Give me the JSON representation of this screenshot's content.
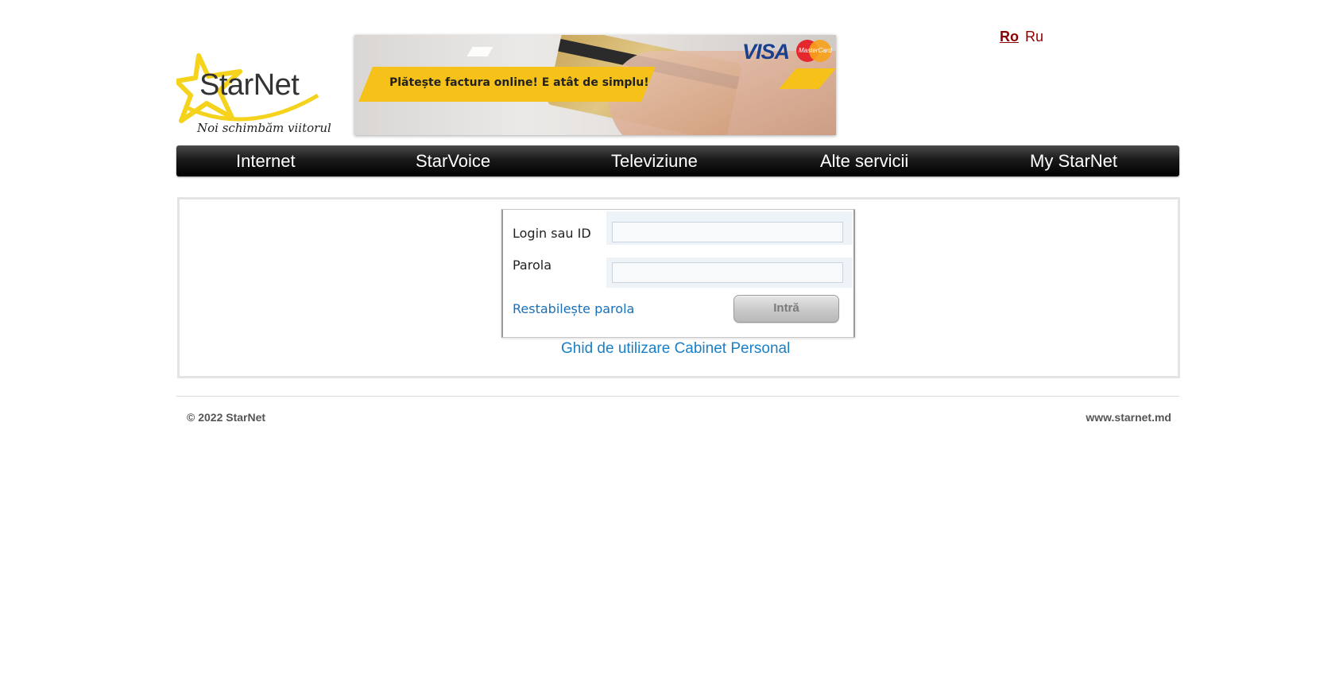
{
  "header": {
    "logo": {
      "name": "StarNet",
      "tagline": "Noi schimbăm viitorul"
    },
    "banner": {
      "text": "Plătește factura online! E atât de simplu!",
      "visa_label": "VISA",
      "mastercard_label": "MasterCard"
    },
    "languages": {
      "ro": "Ro",
      "ru": "Ru"
    }
  },
  "nav": {
    "items": [
      {
        "label": "Internet"
      },
      {
        "label": "StarVoice"
      },
      {
        "label": "Televiziune"
      },
      {
        "label": "Alte servicii"
      },
      {
        "label": "My StarNet"
      }
    ]
  },
  "login": {
    "login_label": "Login sau ID",
    "login_value": "",
    "password_label": "Parola",
    "password_value": "",
    "forgot_link": "Restabilește parola",
    "submit_label": "Intră"
  },
  "guide_link": "Ghid de utilizare Cabinet Personal",
  "footer": {
    "copyright": "© 2022 StarNet",
    "website": "www.starnet.md"
  },
  "colors": {
    "nav_bg": "#000000",
    "lang_link": "#8b0000",
    "link_blue": "#1a7fc4",
    "banner_yellow": "#f6c21a",
    "logo_star": "#f5d21c"
  }
}
